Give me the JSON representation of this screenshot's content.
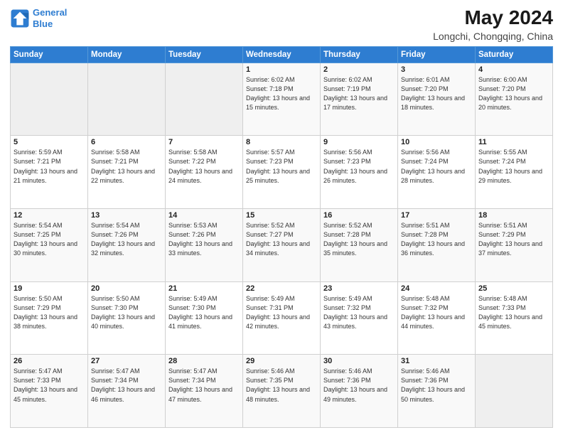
{
  "logo": {
    "line1": "General",
    "line2": "Blue"
  },
  "title": "May 2024",
  "subtitle": "Longchi, Chongqing, China",
  "days_header": [
    "Sunday",
    "Monday",
    "Tuesday",
    "Wednesday",
    "Thursday",
    "Friday",
    "Saturday"
  ],
  "weeks": [
    [
      {
        "day": "",
        "info": ""
      },
      {
        "day": "",
        "info": ""
      },
      {
        "day": "",
        "info": ""
      },
      {
        "day": "1",
        "info": "Sunrise: 6:02 AM\nSunset: 7:18 PM\nDaylight: 13 hours\nand 15 minutes."
      },
      {
        "day": "2",
        "info": "Sunrise: 6:02 AM\nSunset: 7:19 PM\nDaylight: 13 hours\nand 17 minutes."
      },
      {
        "day": "3",
        "info": "Sunrise: 6:01 AM\nSunset: 7:20 PM\nDaylight: 13 hours\nand 18 minutes."
      },
      {
        "day": "4",
        "info": "Sunrise: 6:00 AM\nSunset: 7:20 PM\nDaylight: 13 hours\nand 20 minutes."
      }
    ],
    [
      {
        "day": "5",
        "info": "Sunrise: 5:59 AM\nSunset: 7:21 PM\nDaylight: 13 hours\nand 21 minutes."
      },
      {
        "day": "6",
        "info": "Sunrise: 5:58 AM\nSunset: 7:21 PM\nDaylight: 13 hours\nand 22 minutes."
      },
      {
        "day": "7",
        "info": "Sunrise: 5:58 AM\nSunset: 7:22 PM\nDaylight: 13 hours\nand 24 minutes."
      },
      {
        "day": "8",
        "info": "Sunrise: 5:57 AM\nSunset: 7:23 PM\nDaylight: 13 hours\nand 25 minutes."
      },
      {
        "day": "9",
        "info": "Sunrise: 5:56 AM\nSunset: 7:23 PM\nDaylight: 13 hours\nand 26 minutes."
      },
      {
        "day": "10",
        "info": "Sunrise: 5:56 AM\nSunset: 7:24 PM\nDaylight: 13 hours\nand 28 minutes."
      },
      {
        "day": "11",
        "info": "Sunrise: 5:55 AM\nSunset: 7:24 PM\nDaylight: 13 hours\nand 29 minutes."
      }
    ],
    [
      {
        "day": "12",
        "info": "Sunrise: 5:54 AM\nSunset: 7:25 PM\nDaylight: 13 hours\nand 30 minutes."
      },
      {
        "day": "13",
        "info": "Sunrise: 5:54 AM\nSunset: 7:26 PM\nDaylight: 13 hours\nand 32 minutes."
      },
      {
        "day": "14",
        "info": "Sunrise: 5:53 AM\nSunset: 7:26 PM\nDaylight: 13 hours\nand 33 minutes."
      },
      {
        "day": "15",
        "info": "Sunrise: 5:52 AM\nSunset: 7:27 PM\nDaylight: 13 hours\nand 34 minutes."
      },
      {
        "day": "16",
        "info": "Sunrise: 5:52 AM\nSunset: 7:28 PM\nDaylight: 13 hours\nand 35 minutes."
      },
      {
        "day": "17",
        "info": "Sunrise: 5:51 AM\nSunset: 7:28 PM\nDaylight: 13 hours\nand 36 minutes."
      },
      {
        "day": "18",
        "info": "Sunrise: 5:51 AM\nSunset: 7:29 PM\nDaylight: 13 hours\nand 37 minutes."
      }
    ],
    [
      {
        "day": "19",
        "info": "Sunrise: 5:50 AM\nSunset: 7:29 PM\nDaylight: 13 hours\nand 38 minutes."
      },
      {
        "day": "20",
        "info": "Sunrise: 5:50 AM\nSunset: 7:30 PM\nDaylight: 13 hours\nand 40 minutes."
      },
      {
        "day": "21",
        "info": "Sunrise: 5:49 AM\nSunset: 7:30 PM\nDaylight: 13 hours\nand 41 minutes."
      },
      {
        "day": "22",
        "info": "Sunrise: 5:49 AM\nSunset: 7:31 PM\nDaylight: 13 hours\nand 42 minutes."
      },
      {
        "day": "23",
        "info": "Sunrise: 5:49 AM\nSunset: 7:32 PM\nDaylight: 13 hours\nand 43 minutes."
      },
      {
        "day": "24",
        "info": "Sunrise: 5:48 AM\nSunset: 7:32 PM\nDaylight: 13 hours\nand 44 minutes."
      },
      {
        "day": "25",
        "info": "Sunrise: 5:48 AM\nSunset: 7:33 PM\nDaylight: 13 hours\nand 45 minutes."
      }
    ],
    [
      {
        "day": "26",
        "info": "Sunrise: 5:47 AM\nSunset: 7:33 PM\nDaylight: 13 hours\nand 45 minutes."
      },
      {
        "day": "27",
        "info": "Sunrise: 5:47 AM\nSunset: 7:34 PM\nDaylight: 13 hours\nand 46 minutes."
      },
      {
        "day": "28",
        "info": "Sunrise: 5:47 AM\nSunset: 7:34 PM\nDaylight: 13 hours\nand 47 minutes."
      },
      {
        "day": "29",
        "info": "Sunrise: 5:46 AM\nSunset: 7:35 PM\nDaylight: 13 hours\nand 48 minutes."
      },
      {
        "day": "30",
        "info": "Sunrise: 5:46 AM\nSunset: 7:36 PM\nDaylight: 13 hours\nand 49 minutes."
      },
      {
        "day": "31",
        "info": "Sunrise: 5:46 AM\nSunset: 7:36 PM\nDaylight: 13 hours\nand 50 minutes."
      },
      {
        "day": "",
        "info": ""
      }
    ]
  ]
}
